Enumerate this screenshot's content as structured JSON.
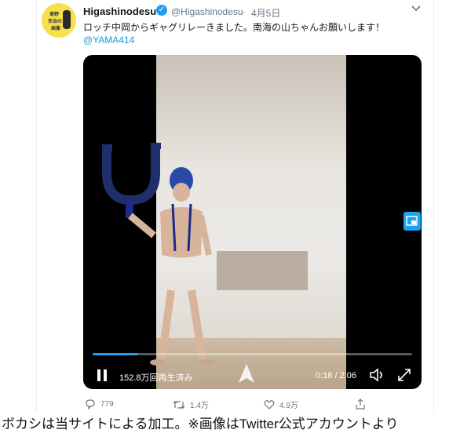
{
  "tweet": {
    "author_name": "Higashinodesu",
    "handle": "@Higashinodesu",
    "separator": "·",
    "date": "4月5日",
    "text": "ロッチ中岡からギャグリレーきました。南海の山ちゃんお願いします！",
    "mention": "@YAMA414",
    "avatar_lines": [
      "東野",
      "幸治の",
      "画像"
    ]
  },
  "video": {
    "views": "152.8万回再生済み",
    "time": "0:18 / 2:06",
    "progress": 0.143
  },
  "actions": {
    "replies": "779",
    "retweets": "1.4万",
    "likes": "4.9万"
  },
  "caption": "ボカシは当サイトによる加工。※画像はTwitter公式アカウントより",
  "colors": {
    "accent": "#1da1f2",
    "text": "#14171a",
    "muted": "#657786"
  }
}
